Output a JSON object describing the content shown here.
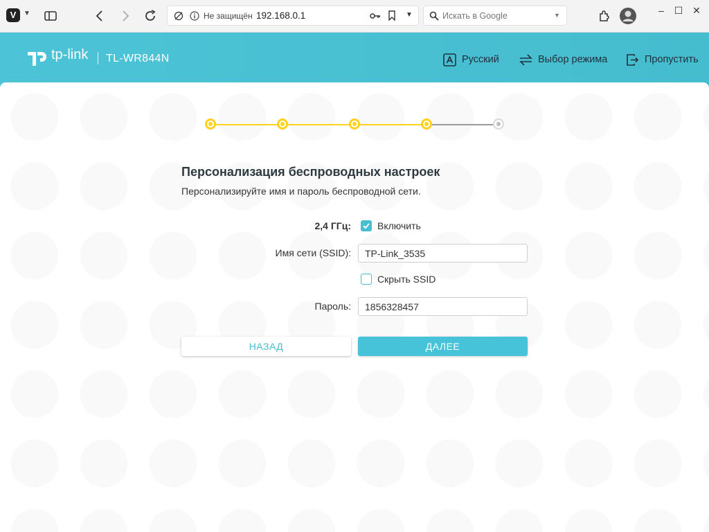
{
  "browser": {
    "security_warning": "Не защищён",
    "url": "192.168.0.1",
    "search_placeholder": "Искать в Google"
  },
  "header": {
    "brand": "tp-link",
    "model": "TL-WR844N",
    "language_label": "Русский",
    "mode_label": "Выбор режима",
    "skip_label": "Пропустить"
  },
  "progress": {
    "total_steps": 5,
    "completed_steps": 4,
    "accent_color": "#ffd21e"
  },
  "page": {
    "title": "Персонализация беспроводных настроек",
    "subtitle": "Персонализируйте имя и пароль беспроводной сети."
  },
  "form": {
    "band_label": "2,4 ГГц:",
    "enable_label": "Включить",
    "enable_checked": true,
    "ssid_label": "Имя сети (SSID):",
    "ssid_value": "TP-Link_3535",
    "hide_ssid_label": "Скрыть SSID",
    "hide_ssid_checked": false,
    "password_label": "Пароль:",
    "password_value": "1856328457"
  },
  "buttons": {
    "back_label": "НАЗАД",
    "next_label": "ДАЛЕЕ"
  },
  "colors": {
    "header": "#4dc3d7",
    "accent": "#46bdd1"
  }
}
